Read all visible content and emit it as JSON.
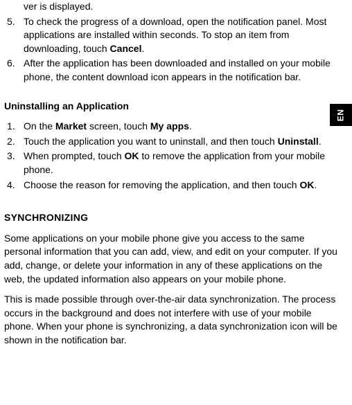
{
  "lang_tab": "EN",
  "partial_line": "ver is displayed.",
  "list1": {
    "item5_num": "5.",
    "item5_before": "To check the progress of a download, open the notification panel. Most applications are installed within seconds. To stop an item from downloading, touch ",
    "item5_bold": "Cancel",
    "item5_after": ".",
    "item6_num": "6.",
    "item6_text": "After the application has been downloaded and installed on your mobile phone, the content download icon appears in the notification bar."
  },
  "heading1": "Uninstalling an Application",
  "list2": {
    "item1_num": "1.",
    "item1_a": "On the ",
    "item1_b": "Market",
    "item1_c": " screen, touch ",
    "item1_d": "My apps",
    "item1_e": ".",
    "item2_num": "2.",
    "item2_a": "Touch the application you want to uninstall, and then touch ",
    "item2_b": "Uninstall",
    "item2_c": ".",
    "item3_num": "3.",
    "item3_a": "When prompted, touch ",
    "item3_b": "OK",
    "item3_c": " to remove the application from your mobile phone.",
    "item4_num": "4.",
    "item4_a": "Choose the reason for removing the application, and then touch ",
    "item4_b": "OK",
    "item4_c": "."
  },
  "heading2": "SYNCHRONIZING",
  "para1": "Some applications on your mobile phone give you access to the same personal information that you can add, view, and edit on your computer. If you add, change, or delete your information in any of these applications on the web, the updated information also appears on your mobile phone.",
  "para2": "This is made possible through over-the-air data synchronization. The process occurs in the background and does not interfere with use of your mobile phone. When your phone is synchroni­zing, a data synchronization icon will be shown in the notifica­tion bar."
}
